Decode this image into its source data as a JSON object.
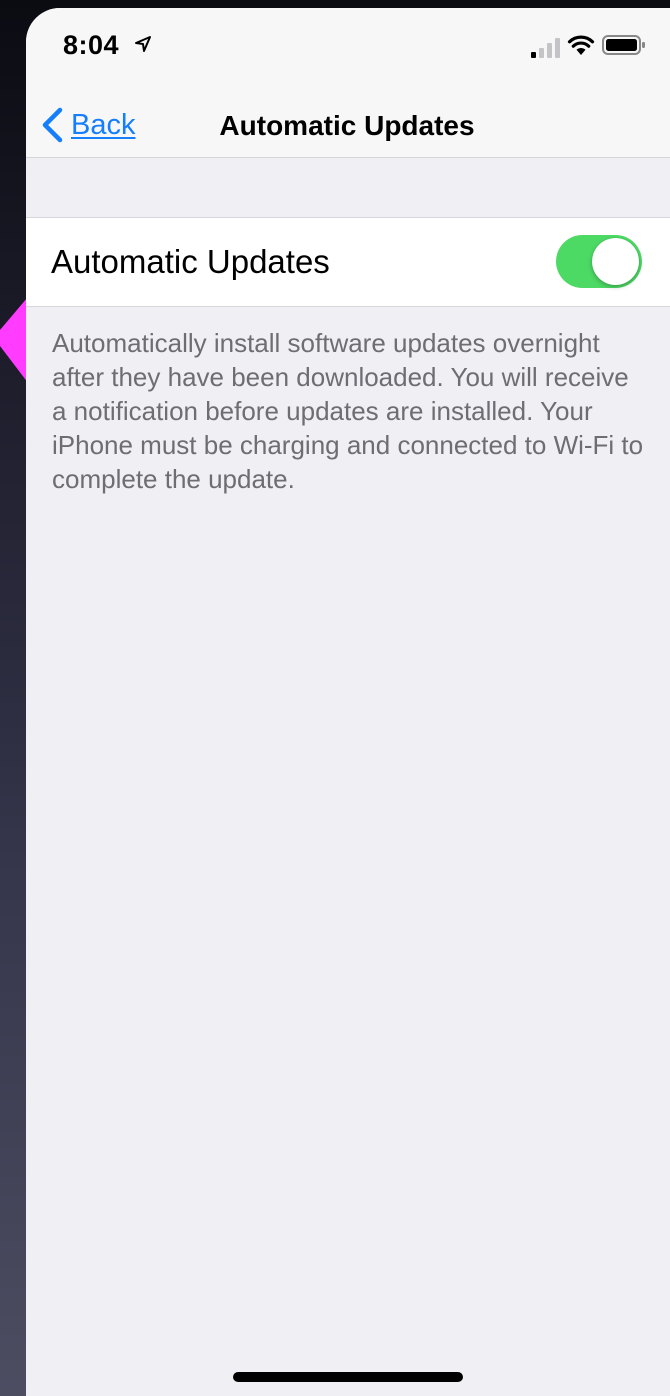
{
  "status_bar": {
    "time": "8:04",
    "icons": [
      "location-arrow-icon",
      "signal-icon",
      "wifi-icon",
      "battery-icon"
    ]
  },
  "nav": {
    "back_label": "Back",
    "title": "Automatic Updates"
  },
  "setting": {
    "label": "Automatic Updates",
    "toggle_on": true
  },
  "footer": {
    "text": "Automatically install software updates overnight after they have been downloaded. You will receive a notification before updates are installed. Your iPhone must be charging and connected to Wi-Fi to complete the update."
  },
  "colors": {
    "accent_blue": "#157efb",
    "toggle_green": "#4cd964",
    "annotation_magenta": "#ff3cff"
  }
}
